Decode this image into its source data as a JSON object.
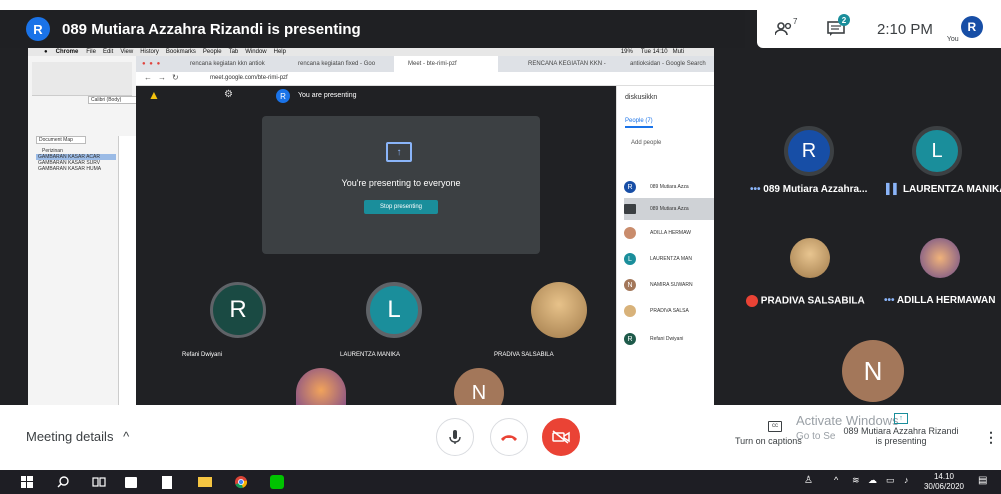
{
  "header": {
    "avatar_letter": "R",
    "title": "089 Mutiara Azzahra Rizandi is presenting"
  },
  "topright": {
    "people_count": "7",
    "chat_badge": "2",
    "time": "2:10 PM",
    "you_avatar": "R",
    "you_label": "You"
  },
  "mac_menubar": {
    "items": [
      "Chrome",
      "File",
      "Edit",
      "View",
      "History",
      "Bookmarks",
      "People",
      "Tab",
      "Window",
      "Help"
    ],
    "status": "19%",
    "clock": "Tue 14:10",
    "user": "Muti"
  },
  "browser": {
    "tabs": [
      "rencana kegiatan kkn antiok",
      "rencana kegiatan fixed - Goo",
      "Meet - bte-rimi-pzf",
      "RENCANA KEGIATAN KKN - ",
      "antioksidan - Google Search"
    ],
    "url": "meet.google.com/bte-rimi-pzf"
  },
  "word_doc": {
    "font_name": "Calibri (Body)",
    "doc_map_label": "Document Map",
    "doc_map_items": [
      "Perizinan",
      "GAMBARAN KASAR ACAR",
      "GAMBARAN KASAR SURV",
      "GAMBARAN KASAR HUMA"
    ]
  },
  "inner_meet": {
    "presenting_avatar": "R",
    "presenting_label": "You are presenting",
    "presenting_msg": "You're presenting to everyone",
    "stop_button": "Stop presenting",
    "tiles": [
      {
        "avatar": "R",
        "name": "Refani Dwiyani"
      },
      {
        "avatar": "L",
        "name": "LAURENTZA MANIKA"
      },
      {
        "avatar": "",
        "name": "PRADIVA SALSABILA"
      },
      {
        "avatar": "N",
        "name": ""
      }
    ],
    "panel_title": "diskusikkn",
    "people_tab": "People (7)",
    "add_people": "Add people",
    "people": [
      {
        "avatar": "R",
        "name": "089 Mutiara Azza"
      },
      {
        "avatar": "",
        "name": "089 Mutiara Azza"
      },
      {
        "avatar": "",
        "name": "ADILLA HERMAW"
      },
      {
        "avatar": "L",
        "name": "LAURENTZA MAN"
      },
      {
        "avatar": "N",
        "name": "NAMIRA SUWARN"
      },
      {
        "avatar": "",
        "name": "PRADIVA SALSA"
      },
      {
        "avatar": "R",
        "name": "Refani Dwiyani"
      }
    ]
  },
  "right_tiles": [
    {
      "avatar": "R",
      "name": "089 Mutiara Azzahra..."
    },
    {
      "avatar": "L",
      "name": "LAURENTZA MANIKA"
    },
    {
      "avatar": "",
      "name": "PRADIVA SALSABILA"
    },
    {
      "avatar": "",
      "name": "ADILLA HERMAWAN"
    },
    {
      "avatar": "N",
      "name": ""
    }
  ],
  "bottom": {
    "meeting_details": "Meeting details",
    "captions_label": "Turn on captions",
    "activate_windows": "Activate Windows",
    "go_to_settings": "Go to Se",
    "presenter_name": "089 Mutiara Azzahra Rizandi",
    "presenter_status": "is presenting"
  },
  "taskbar": {
    "time": "14.10",
    "date": "30/06/2020"
  },
  "colors": {
    "topbar_bg": "#1f2023",
    "stop_red": "#ea4335",
    "teal": "#1a8e9b",
    "blue_avatar": "#1a73e8",
    "dark_blue_avatar": "#174ea6",
    "green_avatar": "#1e8e3e",
    "tile_bg": "#3c4043"
  }
}
